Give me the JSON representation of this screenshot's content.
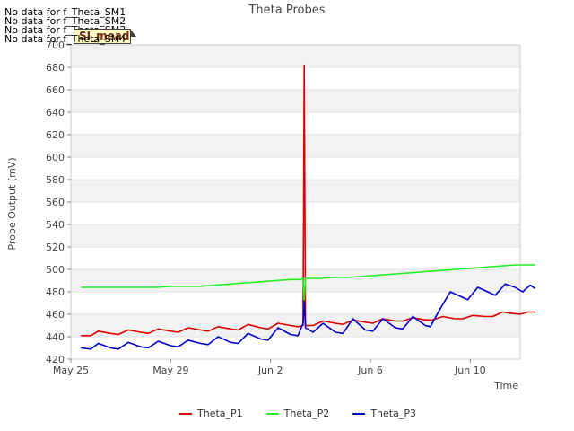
{
  "chart_data": {
    "type": "line",
    "title": "Theta Probes",
    "xlabel": "Time",
    "ylabel": "Probe Output (mV)",
    "ylim": [
      420,
      700
    ],
    "yticks": [
      420,
      440,
      460,
      480,
      500,
      520,
      540,
      560,
      580,
      600,
      620,
      640,
      660,
      680,
      700
    ],
    "xlim": [
      0,
      18
    ],
    "xticks": [
      {
        "x": 0,
        "label": "May 25"
      },
      {
        "x": 4,
        "label": "May 29"
      },
      {
        "x": 8,
        "label": "Jun 2"
      },
      {
        "x": 12,
        "label": "Jun 6"
      },
      {
        "x": 16,
        "label": "Jun 10"
      }
    ],
    "grid": "horizontal bands",
    "legend_position": "bottom",
    "series": [
      {
        "name": "Theta_P1",
        "color": "#dd0000",
        "points": [
          [
            0.4,
            441
          ],
          [
            0.8,
            441
          ],
          [
            1.1,
            445
          ],
          [
            1.6,
            443
          ],
          [
            1.9,
            442
          ],
          [
            2.3,
            446
          ],
          [
            2.8,
            444
          ],
          [
            3.1,
            443
          ],
          [
            3.5,
            447
          ],
          [
            4.0,
            445
          ],
          [
            4.3,
            444
          ],
          [
            4.7,
            448
          ],
          [
            5.2,
            446
          ],
          [
            5.5,
            445
          ],
          [
            5.9,
            449
          ],
          [
            6.4,
            447
          ],
          [
            6.7,
            446
          ],
          [
            7.1,
            451
          ],
          [
            7.6,
            448
          ],
          [
            7.9,
            447
          ],
          [
            8.3,
            452
          ],
          [
            8.8,
            450
          ],
          [
            9.1,
            449
          ],
          [
            9.3,
            450
          ],
          [
            9.35,
            682
          ],
          [
            9.4,
            450
          ],
          [
            9.7,
            450
          ],
          [
            10.1,
            454
          ],
          [
            10.6,
            452
          ],
          [
            10.9,
            451
          ],
          [
            11.3,
            455
          ],
          [
            11.8,
            453
          ],
          [
            12.1,
            452
          ],
          [
            12.5,
            456
          ],
          [
            13.0,
            454
          ],
          [
            13.3,
            454
          ],
          [
            13.7,
            457
          ],
          [
            14.2,
            455
          ],
          [
            14.5,
            455
          ],
          [
            14.9,
            458
          ],
          [
            15.4,
            456
          ],
          [
            15.7,
            456
          ],
          [
            16.1,
            459
          ],
          [
            16.6,
            458
          ],
          [
            16.9,
            458
          ],
          [
            17.3,
            462
          ],
          [
            17.6,
            461
          ],
          [
            18.0,
            460
          ],
          [
            18.3,
            462
          ],
          [
            18.6,
            462
          ]
        ]
      },
      {
        "name": "Theta_P2",
        "color": "#22ee22",
        "points": [
          [
            0.4,
            484
          ],
          [
            1.0,
            484
          ],
          [
            1.6,
            484
          ],
          [
            2.2,
            484
          ],
          [
            2.8,
            484
          ],
          [
            3.4,
            484
          ],
          [
            4.0,
            485
          ],
          [
            4.6,
            485
          ],
          [
            5.2,
            485
          ],
          [
            5.8,
            486
          ],
          [
            6.4,
            487
          ],
          [
            7.0,
            488
          ],
          [
            7.6,
            489
          ],
          [
            8.2,
            490
          ],
          [
            8.8,
            491
          ],
          [
            9.2,
            491
          ],
          [
            9.3,
            492
          ],
          [
            9.35,
            472
          ],
          [
            9.4,
            492
          ],
          [
            10.0,
            492
          ],
          [
            10.6,
            493
          ],
          [
            11.2,
            493
          ],
          [
            11.8,
            494
          ],
          [
            12.4,
            495
          ],
          [
            13.0,
            496
          ],
          [
            13.6,
            497
          ],
          [
            14.2,
            498
          ],
          [
            14.8,
            499
          ],
          [
            15.4,
            500
          ],
          [
            16.0,
            501
          ],
          [
            16.6,
            502
          ],
          [
            17.2,
            503
          ],
          [
            17.8,
            504
          ],
          [
            18.4,
            504
          ],
          [
            18.6,
            504
          ]
        ]
      },
      {
        "name": "Theta_P3",
        "color": "#0000cc",
        "points": [
          [
            0.4,
            430
          ],
          [
            0.8,
            429
          ],
          [
            1.1,
            434
          ],
          [
            1.6,
            430
          ],
          [
            1.9,
            429
          ],
          [
            2.3,
            435
          ],
          [
            2.8,
            431
          ],
          [
            3.1,
            430
          ],
          [
            3.5,
            436
          ],
          [
            4.0,
            432
          ],
          [
            4.3,
            431
          ],
          [
            4.7,
            437
          ],
          [
            5.2,
            434
          ],
          [
            5.5,
            433
          ],
          [
            5.9,
            440
          ],
          [
            6.4,
            435
          ],
          [
            6.7,
            434
          ],
          [
            7.1,
            443
          ],
          [
            7.6,
            438
          ],
          [
            7.9,
            437
          ],
          [
            8.3,
            448
          ],
          [
            8.8,
            442
          ],
          [
            9.1,
            441
          ],
          [
            9.3,
            452
          ],
          [
            9.35,
            472
          ],
          [
            9.4,
            448
          ],
          [
            9.7,
            444
          ],
          [
            10.1,
            452
          ],
          [
            10.6,
            444
          ],
          [
            10.9,
            443
          ],
          [
            11.3,
            456
          ],
          [
            11.8,
            446
          ],
          [
            12.1,
            445
          ],
          [
            12.5,
            456
          ],
          [
            13.0,
            448
          ],
          [
            13.3,
            447
          ],
          [
            13.7,
            458
          ],
          [
            14.2,
            450
          ],
          [
            14.4,
            449
          ],
          [
            14.8,
            465
          ],
          [
            15.2,
            480
          ],
          [
            15.6,
            476
          ],
          [
            15.9,
            473
          ],
          [
            16.3,
            484
          ],
          [
            16.7,
            480
          ],
          [
            17.0,
            477
          ],
          [
            17.4,
            487
          ],
          [
            17.8,
            484
          ],
          [
            18.1,
            480
          ],
          [
            18.4,
            486
          ],
          [
            18.6,
            483
          ]
        ]
      }
    ]
  },
  "nodata_lines": [
    "No data for f_Theta_SM1",
    "No data for f_Theta_SM2",
    "No data for f_Theta_SM3",
    "No data for f_Theta_SM4"
  ],
  "badge_label": "SI_mead"
}
